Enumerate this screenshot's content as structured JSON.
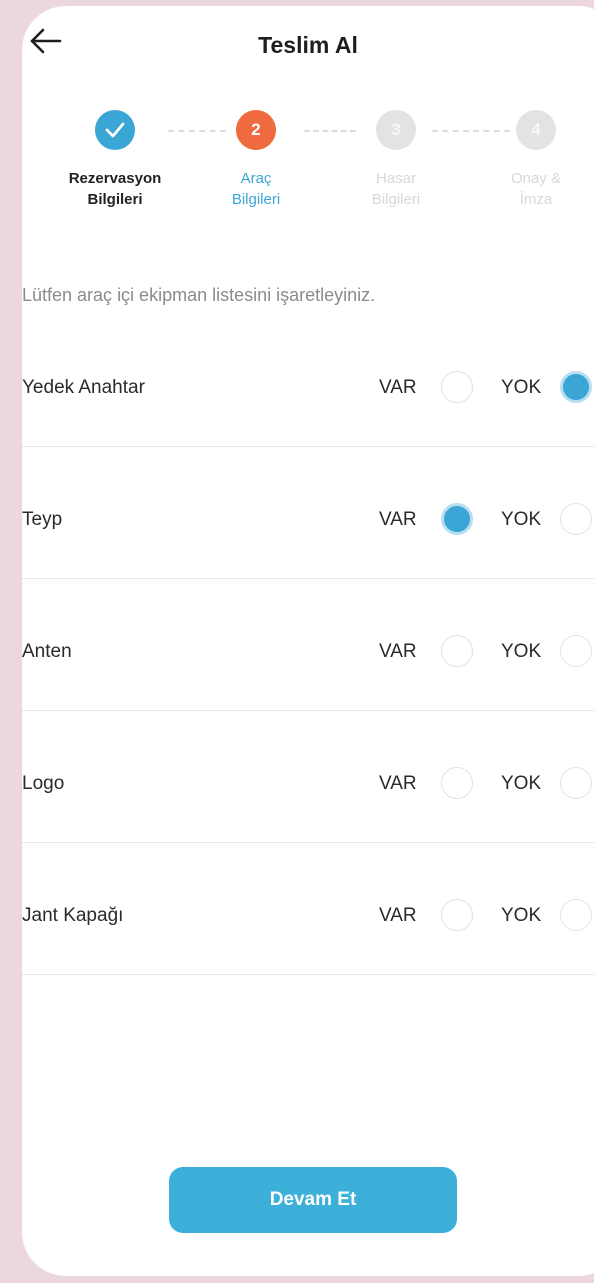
{
  "header": {
    "back_icon": "arrow-left-icon",
    "title": "Teslim Al"
  },
  "stepper": {
    "steps": [
      {
        "number": "",
        "icon": "check-icon",
        "label": "Rezervasyon\nBilgileri",
        "state": "done"
      },
      {
        "number": "2",
        "label": "Araç\nBilgileri",
        "state": "active"
      },
      {
        "number": "3",
        "label": "Hasar\nBilgileri",
        "state": "pending"
      },
      {
        "number": "4",
        "label": "Onay &\nİmza",
        "state": "pending"
      }
    ]
  },
  "instruction": "Lütfen araç içi ekipman listesini işaretleyiniz.",
  "option_labels": {
    "var": "VAR",
    "yok": "YOK"
  },
  "items": [
    {
      "label": "Yedek Anahtar",
      "selected": "yok"
    },
    {
      "label": "Teyp",
      "selected": "var"
    },
    {
      "label": "Anten",
      "selected": ""
    },
    {
      "label": "Logo",
      "selected": ""
    },
    {
      "label": "Jant Kapağı",
      "selected": ""
    }
  ],
  "continue_button": "Devam Et",
  "colors": {
    "accent": "#3aa6d6",
    "active_step": "#ef6a3e",
    "pending_step": "#e3e3e3",
    "button": "#3db0d9"
  }
}
